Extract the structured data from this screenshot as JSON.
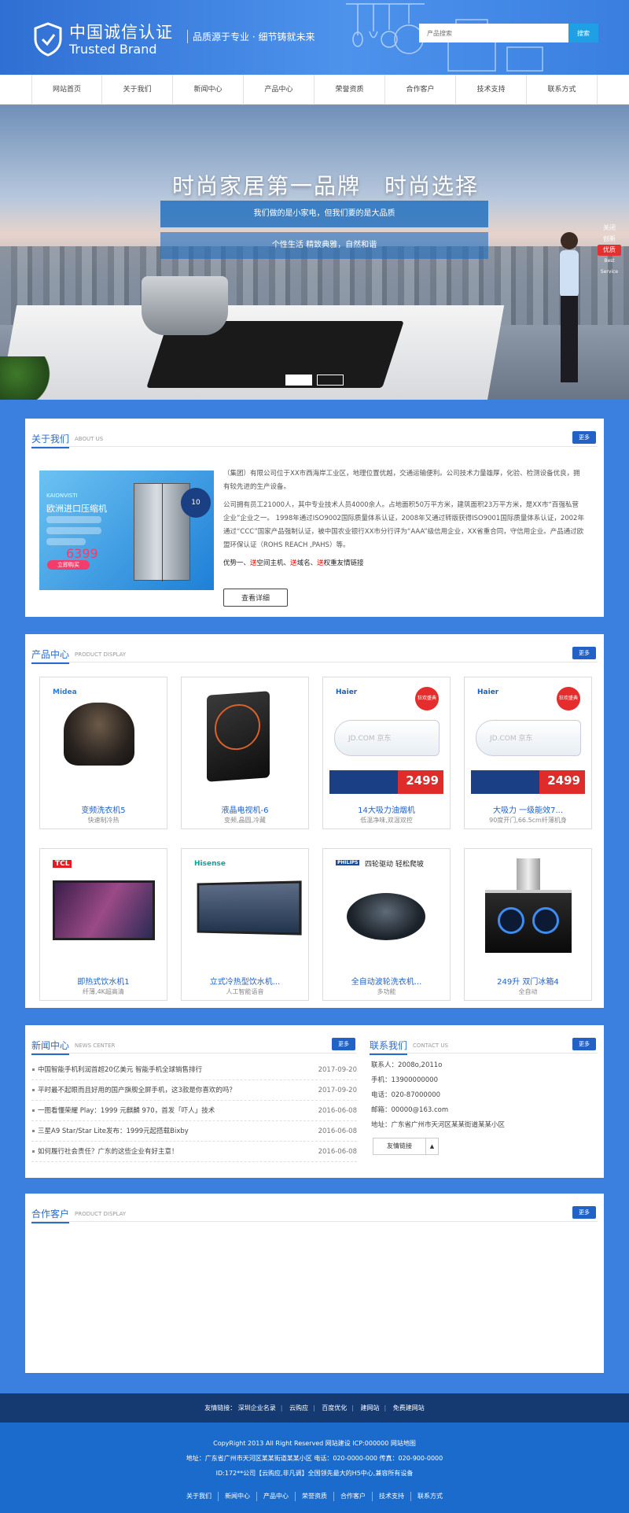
{
  "header": {
    "logo_cn": "中国诚信认证",
    "logo_en": "Trusted Brand",
    "slogan": "品质源于专业 · 细节铸就未来",
    "search_placeholder": "产品搜索",
    "search_button": "搜索"
  },
  "nav": [
    "网站首页",
    "关于我们",
    "新闻中心",
    "产品中心",
    "荣誉资质",
    "合作客户",
    "技术支持",
    "联系方式"
  ],
  "banner": {
    "title": "时尚家居第一品牌　时尚选择",
    "line1": "我们做的是小家电，但我们要的是大品质",
    "line2": "个性生活 精致典雅，自然和谐",
    "side": [
      "关闭",
      "创新",
      "优质",
      "Best Service"
    ]
  },
  "about": {
    "title": "关于我们",
    "title_en": "ABOUT US",
    "more": "更多",
    "promo_small": "KAIONVISTI",
    "promo_title": "欧洲进口压缩机",
    "promo_price": "6399",
    "promo_buy": "立即购买",
    "promo_badge": "10",
    "p1": "（集团）有限公司位于XX市西海岸工业区，地理位置优越，交通运输便利。公司技术力量雄厚，化验、检测设备优良，拥有较先进的生产设备。",
    "p2": "公司拥有员工21000人，其中专业技术人员4000余人。占地面积50万平方米，建筑面积23万平方米，是XX市“百强私营企业”企业之一。 1998年通过ISO9002国际质量体系认证，2008年又通过转版获得ISO9001国际质量体系认证，2002年通过“CCC”国家产品强制认证，被中国农业银行XX市分行评为“AAA”级信用企业，XX省重合同，守信用企业。产品通过欧盟环保认证（ROHS REACH ,PAHS）等。",
    "adv_prefix": "优势一、",
    "adv_items": [
      "送",
      "空间主机、",
      "送",
      "域名、",
      "送",
      "权重友情链接"
    ],
    "detail_btn": "查看详细"
  },
  "products": {
    "title": "产品中心",
    "title_en": "PRODUCT DISPLAY",
    "more": "更多",
    "items": [
      {
        "name": "变频洗衣机5",
        "desc": "快速制冷热",
        "brand": "Midea",
        "kind": "cooker"
      },
      {
        "name": "液晶电视机-6",
        "desc": "变频,晶圆,冷藏",
        "brand": "",
        "kind": "induct"
      },
      {
        "name": "14大吸力油烟机",
        "desc": "低温净味,双温双控",
        "brand": "Haier",
        "kind": "ac"
      },
      {
        "name": "大吸力 一级能效7...",
        "desc": "90度开门,66.5cm纤薄机身",
        "brand": "Haier",
        "kind": "ac"
      },
      {
        "name": "即热式饮水机1",
        "desc": "纤薄,4K超高清",
        "brand": "TCL",
        "kind": "tv"
      },
      {
        "name": "立式冷热型饮水机...",
        "desc": "人工智能语音",
        "brand": "Hisense",
        "kind": "tv2"
      },
      {
        "name": "全自动波轮洗衣机...",
        "desc": "多功能",
        "brand": "PHILIPS",
        "kind": "robot"
      },
      {
        "name": "249升 双门冰箱4",
        "desc": "全自动",
        "brand": "",
        "kind": "hood"
      }
    ],
    "ac_price": "2499",
    "ac_tag": "狂欢盛典",
    "ac_watermark": "JD.COM 京东",
    "robot_slogan": "四轮驱动 轻松爬坡"
  },
  "news": {
    "title": "新闻中心",
    "title_en": "NEWS CENTER",
    "more": "更多",
    "items": [
      {
        "t": "中国智能手机利润首超20亿美元 智能手机全球销售排行",
        "d": "2017-09-20"
      },
      {
        "t": "平时最不起眼而且好用的国产旗舰全屏手机，这3款是你喜欢的吗？",
        "d": "2017-09-20"
      },
      {
        "t": "一图看懂荣耀 Play：1999 元麒麟 970，首发「吓人」技术",
        "d": "2016-06-08"
      },
      {
        "t": "三星A9 Star/Star Lite发布：1999元起搭载Bixby",
        "d": "2016-06-08"
      },
      {
        "t": "如何履行社会责任？广东的这些企业有好主意！",
        "d": "2016-06-08"
      }
    ]
  },
  "contact": {
    "title": "联系我们",
    "title_en": "CONTACT US",
    "more": "更多",
    "lines": [
      "联系人：2008o,2011o",
      "手机：13900000000",
      "电话：020-87000000",
      "邮箱：00000@163.com",
      "地址：广东省广州市天河区某某街道某某小区"
    ],
    "links_label": "友情链接",
    "links_arrow": "▲"
  },
  "partners": {
    "title": "合作客户",
    "title_en": "PRODUCT DISPLAY",
    "more": "更多"
  },
  "footer": {
    "links_label": "友情链接：",
    "links": [
      "深圳企业名录",
      "云购应",
      "百度优化",
      "建网站",
      "免费建网站"
    ],
    "copyright": "CopyRight 2013 All Right Reserved 网站建设 ICP:000000 网站地图",
    "address": "地址：广东省广州市天河区某某街道某某小区 电话：020-0000-000 传真：020-900-0000",
    "id": "ID:172**公司【云购应,非凡调】全国领先最大的H5中心,兼容所有设备",
    "nav": [
      "关于我们",
      "新闻中心",
      "产品中心",
      "荣誉资质",
      "合作客户",
      "技术支持",
      "联系方式"
    ]
  }
}
